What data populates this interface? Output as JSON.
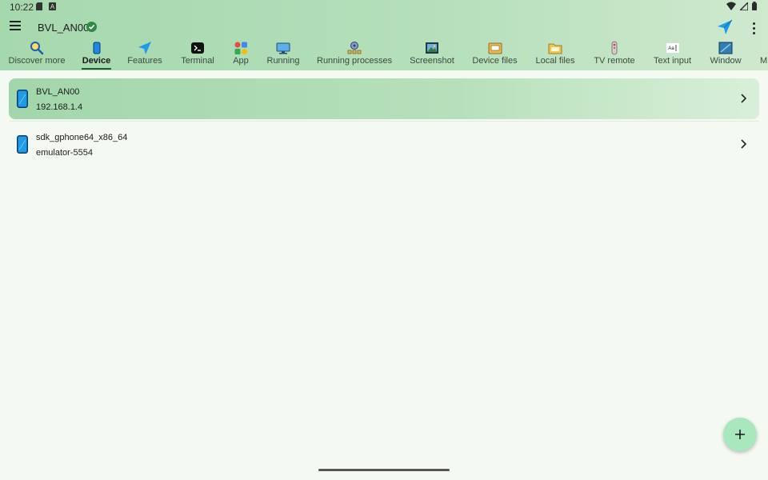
{
  "status_bar": {
    "time": "10:22",
    "icons": [
      "sd-card-icon",
      "a-letter-icon",
      "wifi-icon",
      "signal-icon",
      "battery-icon"
    ]
  },
  "app_bar": {
    "device_name": "BVL_AN00",
    "connected_icon": "check-circle-icon",
    "actions": [
      "send-icon",
      "more-vert-icon"
    ]
  },
  "tabs": [
    {
      "label": "Discover more",
      "icon": "search-icon"
    },
    {
      "label": "Device",
      "icon": "phone-icon",
      "active": true
    },
    {
      "label": "Features",
      "icon": "send-icon"
    },
    {
      "label": "Terminal",
      "icon": "terminal-icon"
    },
    {
      "label": "App",
      "icon": "apps-icon"
    },
    {
      "label": "Running",
      "icon": "monitor-icon"
    },
    {
      "label": "Running processes",
      "icon": "processes-icon"
    },
    {
      "label": "Screenshot",
      "icon": "screenshot-icon"
    },
    {
      "label": "Device files",
      "icon": "device-files-icon"
    },
    {
      "label": "Local files",
      "icon": "folder-icon"
    },
    {
      "label": "TV remote",
      "icon": "remote-icon"
    },
    {
      "label": "Text input",
      "icon": "text-input-icon"
    },
    {
      "label": "Window",
      "icon": "window-icon"
    },
    {
      "label": "M",
      "icon": ""
    }
  ],
  "devices": [
    {
      "name": "BVL_AN00",
      "address": "192.168.1.4",
      "selected": true
    },
    {
      "name": "sdk_gphone64_x86_64",
      "address": "emulator-5554",
      "selected": false
    }
  ],
  "fab": {
    "icon": "plus-icon"
  },
  "colors": {
    "header": "#a6d8ae",
    "accent": "#1f5e34",
    "fab": "#a9e8bf",
    "background": "#f4faf1",
    "phone_icon": "#1e88e5"
  }
}
